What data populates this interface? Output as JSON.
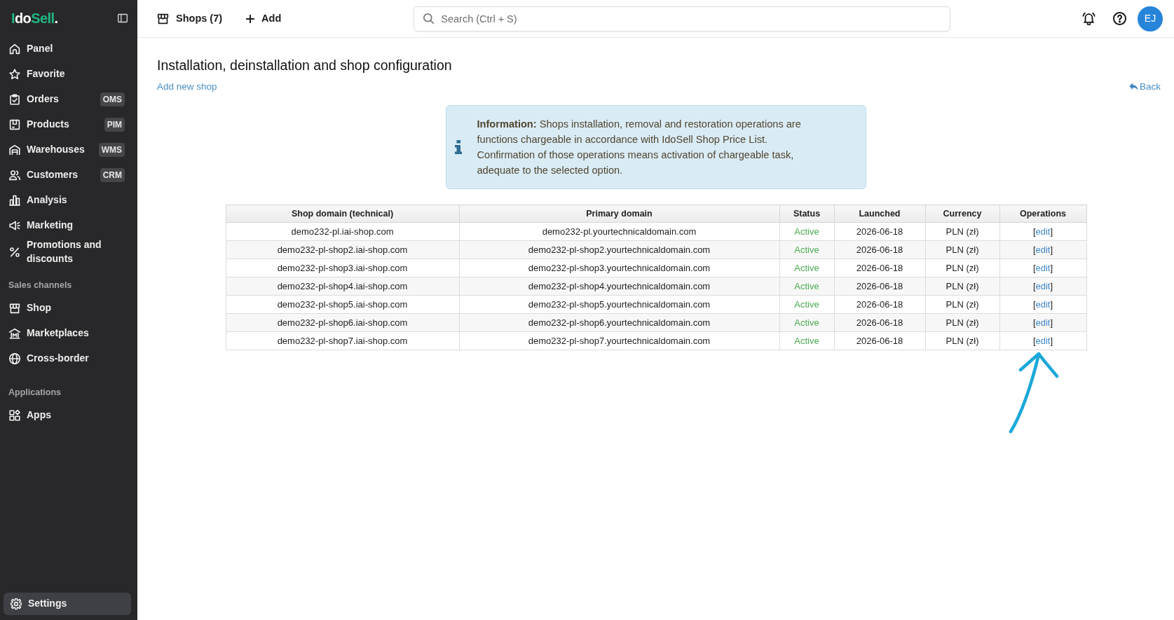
{
  "sidebar": {
    "logo": [
      {
        "text": "I",
        "accent": true
      },
      {
        "text": "do",
        "accent": false
      },
      {
        "text": "Sell",
        "accent": true
      },
      {
        "text": ".",
        "accent": false
      }
    ],
    "sections": [
      {
        "items": [
          {
            "label": "Panel",
            "selected": false
          },
          {
            "label": "Favorite",
            "selected": false
          },
          {
            "label": "Orders",
            "badge": "OMS",
            "selected": false
          },
          {
            "label": "Products",
            "badge": "PIM",
            "selected": false
          },
          {
            "label": "Warehouses",
            "badge": "WMS",
            "selected": false
          },
          {
            "label": "Customers",
            "badge": "CRM",
            "selected": false
          },
          {
            "label": "Analysis",
            "selected": false
          },
          {
            "label": "Marketing",
            "selected": false
          },
          {
            "label": "Promotions and discounts",
            "selected": false
          }
        ]
      },
      {
        "heading": "Sales channels",
        "items": [
          {
            "label": "Shop",
            "selected": false
          },
          {
            "label": "Marketplaces",
            "selected": false
          },
          {
            "label": "Cross-border",
            "selected": false
          }
        ]
      },
      {
        "heading": "Applications",
        "items": [
          {
            "label": "Apps",
            "selected": false
          }
        ]
      }
    ],
    "footer_items": [
      {
        "label": "Settings",
        "selected": true
      }
    ]
  },
  "topbar": {
    "shops_button": "Shops (7)",
    "add_button": "Add",
    "search": {
      "placeholder": "Search (Ctrl + S)"
    },
    "avatar": "EJ"
  },
  "page": {
    "title": "Installation, deinstallation and shop configuration",
    "add_link": "Add new shop",
    "back_link": "Back",
    "info": "**Information:** Shops installation, removal and restoration operations are functions chargeable in accordance with IdoSell Shop Price List. Confirmation of those operations means activation of chargeable task, adequate to the selected option.",
    "table": {
      "columns": [
        "Shop domain (technical)",
        "Primary domain",
        "Status",
        "Launched",
        "Currency",
        "Operations"
      ],
      "rows": [
        {
          "shop_domain": "demo232-pl.iai-shop.com",
          "primary_domain": "demo232-pl.yourtechnicaldomain.com",
          "status": "Active",
          "launched": "2026-06-18",
          "currency": "PLN (zł)",
          "operations": {
            "open": "[",
            "link": "edit",
            "close": "]"
          }
        },
        {
          "shop_domain": "demo232-pl-shop2.iai-shop.com",
          "primary_domain": "demo232-pl-shop2.yourtechnicaldomain.com",
          "status": "Active",
          "launched": "2026-06-18",
          "currency": "PLN (zł)",
          "operations": {
            "open": "[",
            "link": "edit",
            "close": "]"
          }
        },
        {
          "shop_domain": "demo232-pl-shop3.iai-shop.com",
          "primary_domain": "demo232-pl-shop3.yourtechnicaldomain.com",
          "status": "Active",
          "launched": "2026-06-18",
          "currency": "PLN (zł)",
          "operations": {
            "open": "[",
            "link": "edit",
            "close": "]"
          }
        },
        {
          "shop_domain": "demo232-pl-shop4.iai-shop.com",
          "primary_domain": "demo232-pl-shop4.yourtechnicaldomain.com",
          "status": "Active",
          "launched": "2026-06-18",
          "currency": "PLN (zł)",
          "operations": {
            "open": "[",
            "link": "edit",
            "close": "]"
          }
        },
        {
          "shop_domain": "demo232-pl-shop5.iai-shop.com",
          "primary_domain": "demo232-pl-shop5.yourtechnicaldomain.com",
          "status": "Active",
          "launched": "2026-06-18",
          "currency": "PLN (zł)",
          "operations": {
            "open": "[",
            "link": "edit",
            "close": "]"
          }
        },
        {
          "shop_domain": "demo232-pl-shop6.iai-shop.com",
          "primary_domain": "demo232-pl-shop6.yourtechnicaldomain.com",
          "status": "Active",
          "launched": "2026-06-18",
          "currency": "PLN (zł)",
          "operations": {
            "open": "[",
            "link": "edit",
            "close": "]"
          }
        },
        {
          "shop_domain": "demo232-pl-shop7.iai-shop.com",
          "primary_domain": "demo232-pl-shop7.yourtechnicaldomain.com",
          "status": "Active",
          "launched": "2026-06-18",
          "currency": "PLN (zł)",
          "operations": {
            "open": "[",
            "link": "edit",
            "close": "]"
          }
        }
      ]
    }
  }
}
